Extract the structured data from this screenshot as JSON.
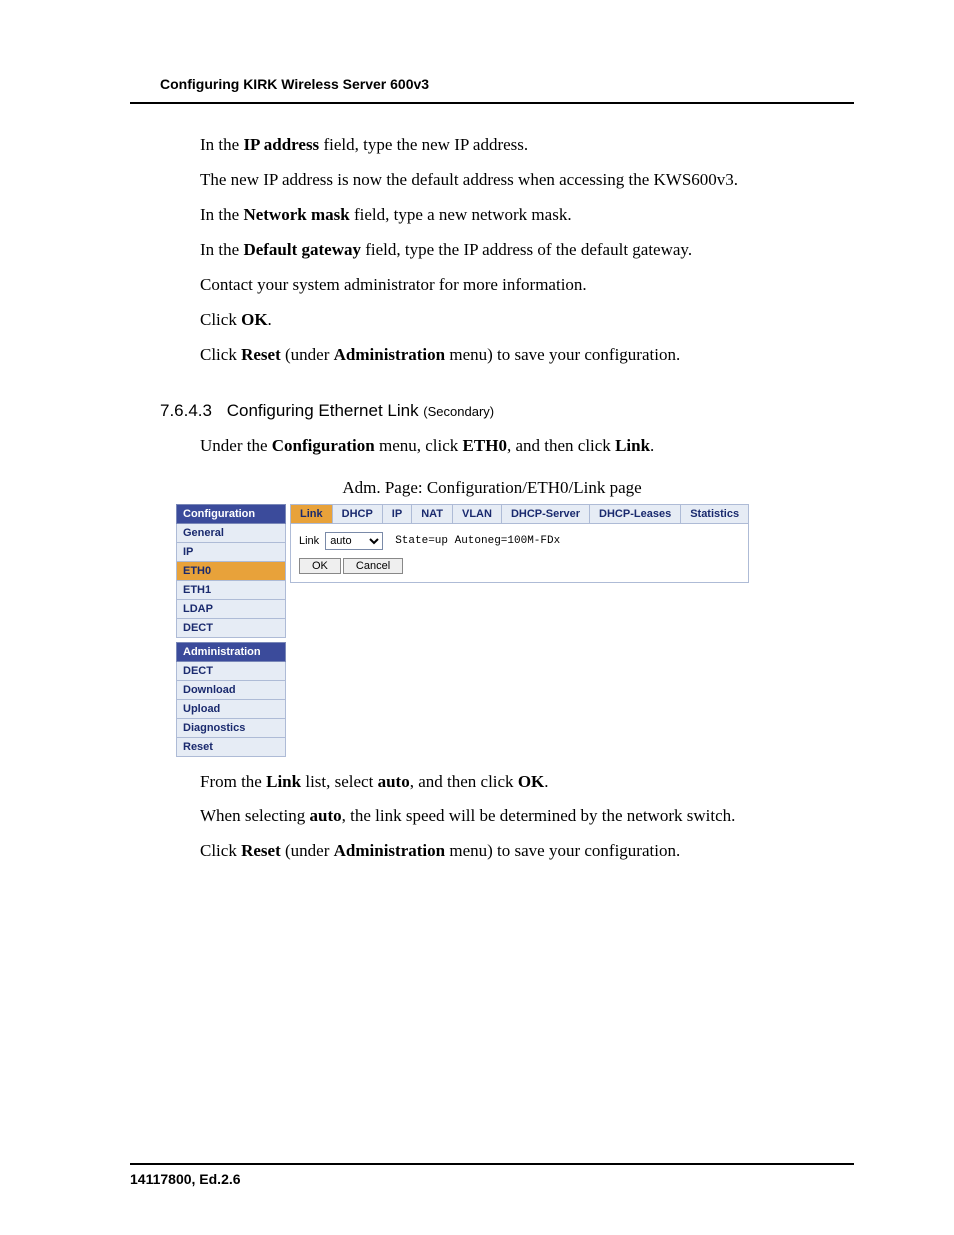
{
  "header": {
    "title": "Configuring KIRK Wireless Server 600v3"
  },
  "body": {
    "p1_a": "In the ",
    "p1_b": "IP address",
    "p1_c": " field, type the new IP address.",
    "p2": "The new IP address is now the default address when accessing the KWS600v3.",
    "p3_a": "In the ",
    "p3_b": "Network mask",
    "p3_c": " field, type a new network mask.",
    "p4_a": "In the ",
    "p4_b": "Default gateway",
    "p4_c": " field, type the IP address of the default gateway.",
    "p5": "Contact your system administrator for more information.",
    "p6_a": "Click ",
    "p6_b": "OK",
    "p6_c": ".",
    "p7_a": "Click ",
    "p7_b": "Reset",
    "p7_c": " (under ",
    "p7_d": "Administration",
    "p7_e": " menu) to save your configuration."
  },
  "section": {
    "number": "7.6.4.3",
    "title": "Configuring Ethernet Link ",
    "sub": "(Secondary)"
  },
  "body2": {
    "p1_a": "Under the ",
    "p1_b": "Configuration",
    "p1_c": " menu, click ",
    "p1_d": "ETH0",
    "p1_e": ", and then click ",
    "p1_f": "Link",
    "p1_g": ".",
    "caption": "Adm. Page: Configuration/ETH0/Link page"
  },
  "adm": {
    "config_hdr": "Configuration",
    "config_items": [
      "General",
      "IP",
      "ETH0",
      "ETH1",
      "LDAP",
      "DECT"
    ],
    "config_active_index": 2,
    "admin_hdr": "Administration",
    "admin_items": [
      "DECT",
      "Download",
      "Upload",
      "Diagnostics",
      "Reset"
    ],
    "tabs": [
      "Link",
      "DHCP",
      "IP",
      "NAT",
      "VLAN",
      "DHCP-Server",
      "DHCP-Leases",
      "Statistics"
    ],
    "tab_active_index": 0,
    "form": {
      "link_label": "Link",
      "link_value": "auto",
      "state_text": "State=up Autoneg=100M-FDx",
      "ok": "OK",
      "cancel": "Cancel"
    }
  },
  "body3": {
    "p1_a": "From the ",
    "p1_b": "Link",
    "p1_c": " list, select ",
    "p1_d": "auto",
    "p1_e": ", and then click ",
    "p1_f": "OK",
    "p1_g": ".",
    "p2_a": "When selecting ",
    "p2_b": "auto",
    "p2_c": ", the link speed will be determined by the network switch.",
    "p3_a": "Click ",
    "p3_b": "Reset",
    "p3_c": " (under ",
    "p3_d": "Administration",
    "p3_e": " menu) to save your configuration."
  },
  "footer": {
    "text": "14117800, Ed.2.6"
  }
}
